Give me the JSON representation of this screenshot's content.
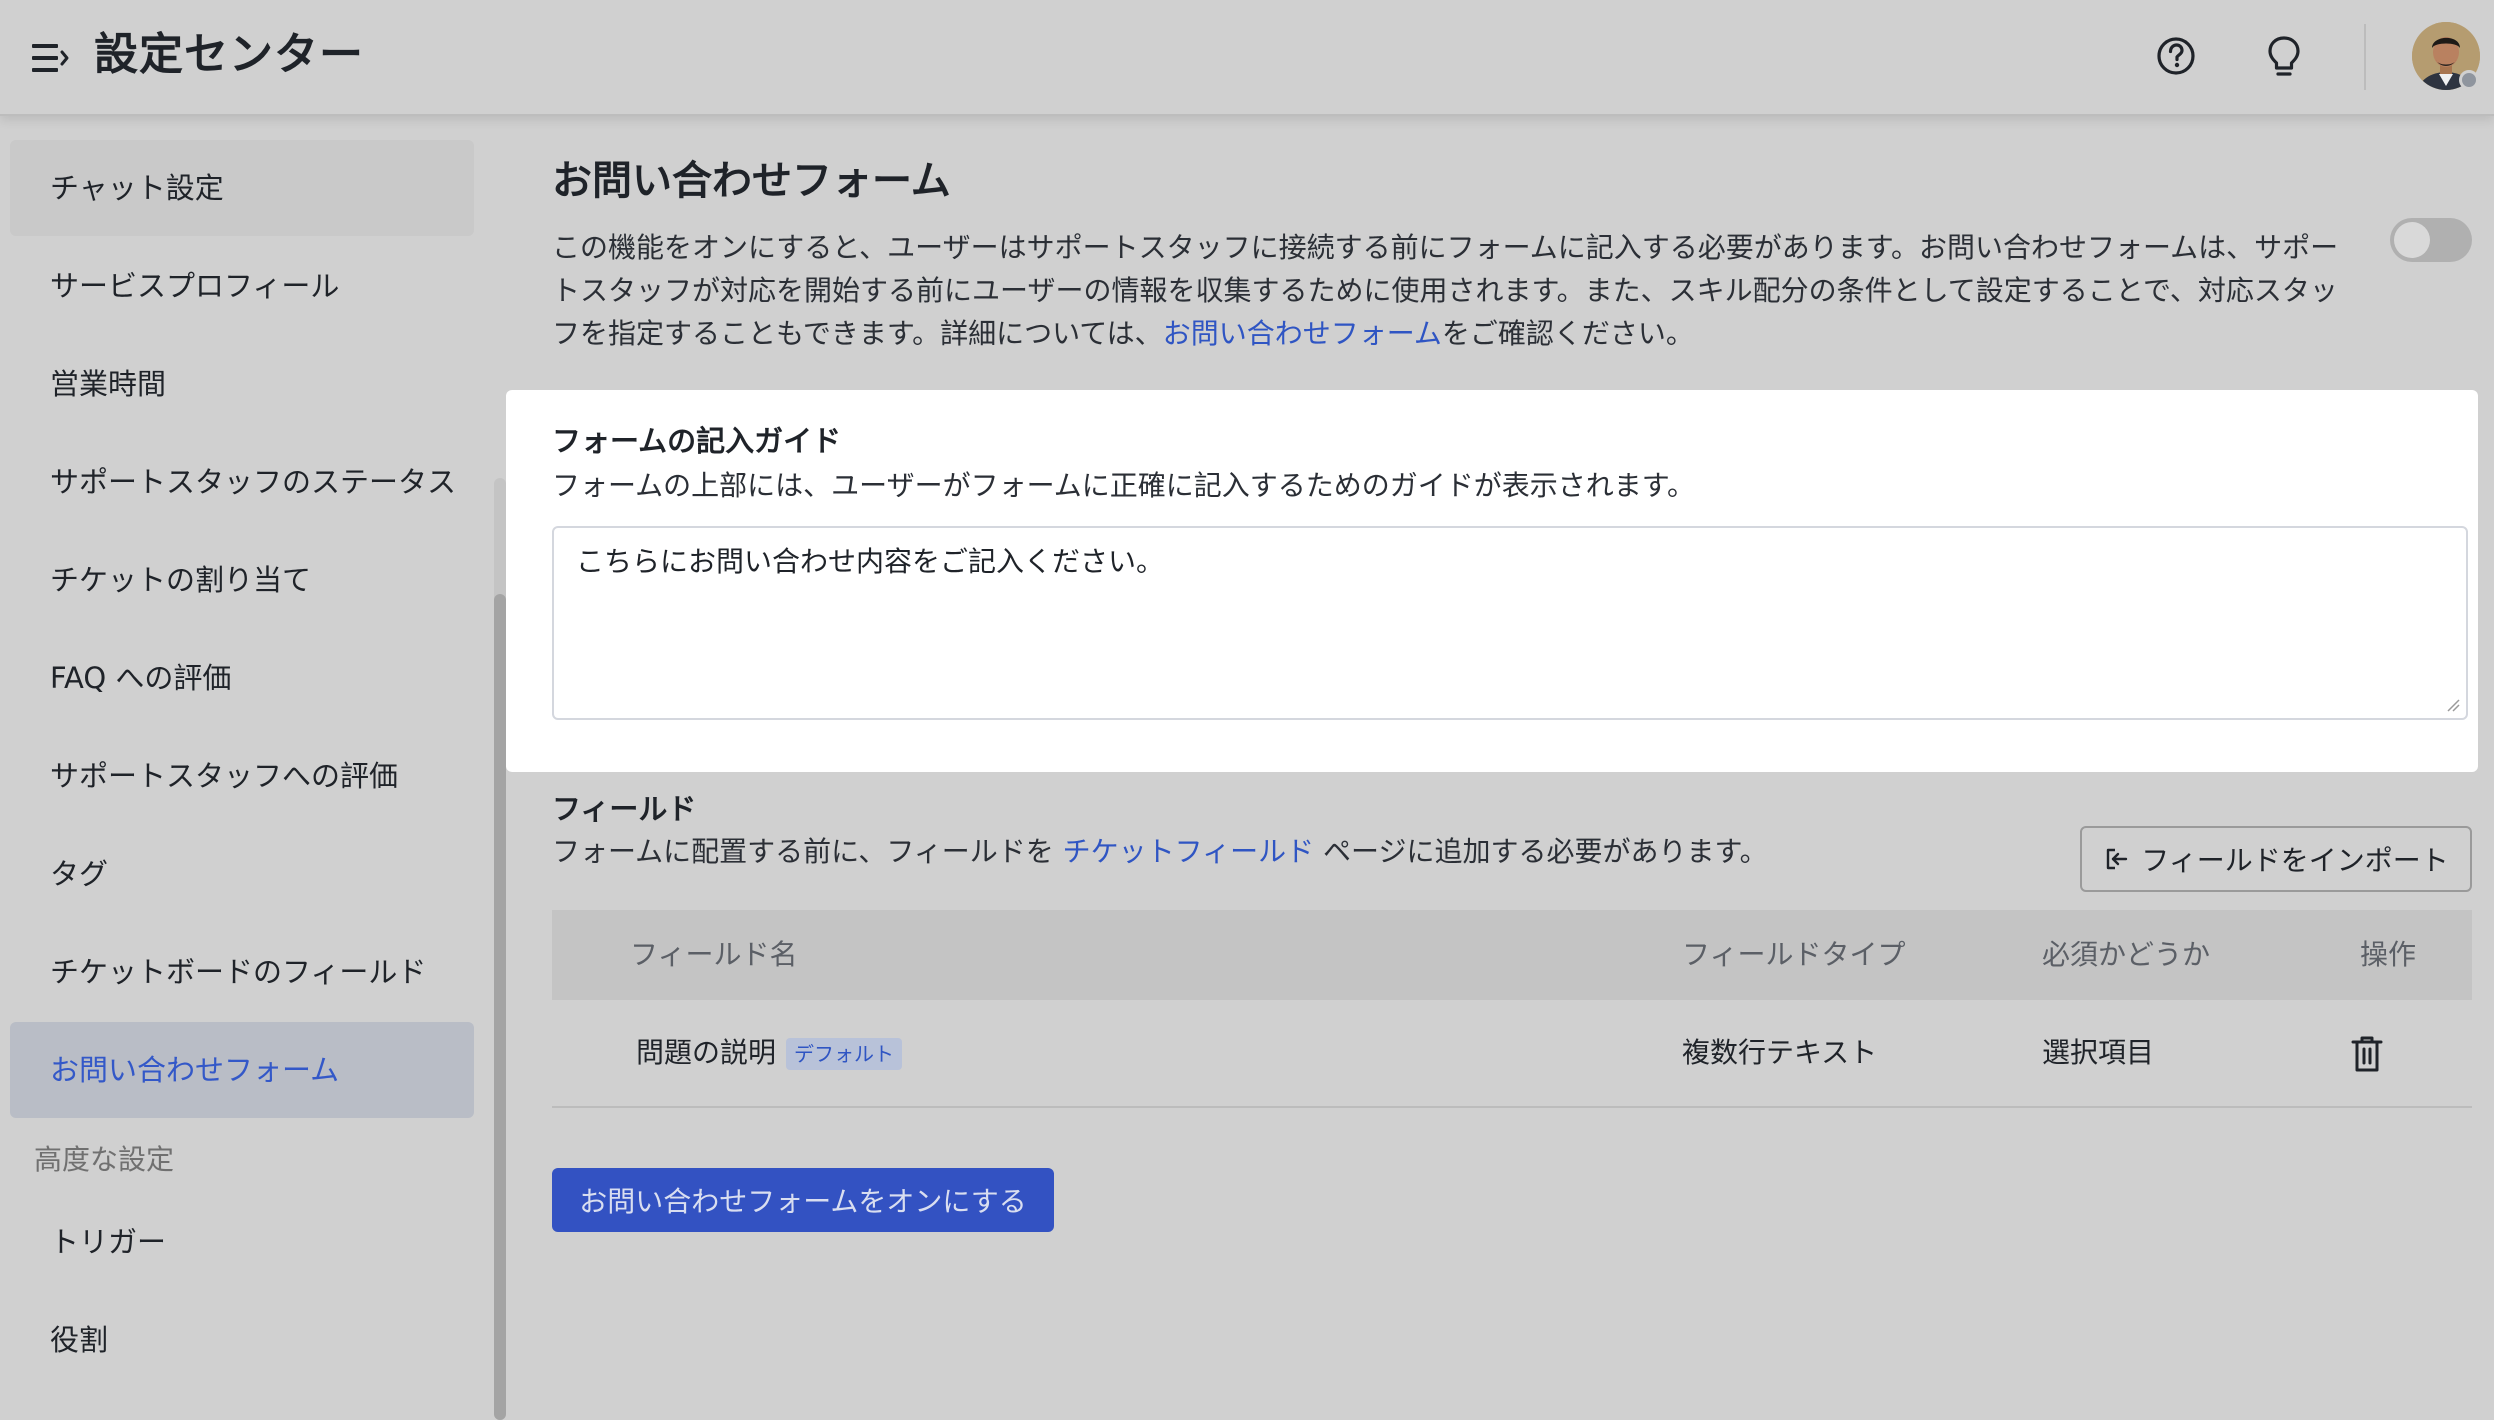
{
  "header": {
    "title": "設定センター"
  },
  "sidebar": {
    "items": [
      {
        "label": "チャット設定"
      },
      {
        "label": "サービスプロフィール"
      },
      {
        "label": "営業時間"
      },
      {
        "label": "サポートスタッフのステータス"
      },
      {
        "label": "チケットの割り当て"
      },
      {
        "label": "FAQ への評価"
      },
      {
        "label": "サポートスタッフへの評価"
      },
      {
        "label": "タグ"
      },
      {
        "label": "チケットボードのフィールド"
      },
      {
        "label": "お問い合わせフォーム"
      }
    ],
    "active_index": 9,
    "section_label": "高度な設定",
    "advanced_items": [
      {
        "label": "トリガー"
      },
      {
        "label": "役割"
      }
    ]
  },
  "main": {
    "heading": "お問い合わせフォーム",
    "toggle_on": false,
    "intro_text": "この機能をオンにすると、ユーザーはサポートスタッフに接続する前にフォームに記入する必要があります。お問い合わせフォームは、サポートスタッフが対応を開始する前にユーザーの情報を収集するために使用されます。また、スキル配分の条件として設定することで、対応スタッフを指定することもできます。詳細については、",
    "intro_link": "お問い合わせフォーム",
    "intro_suffix": "をご確認ください。",
    "guide": {
      "title": "フォームの記入ガイド",
      "subtitle": "フォームの上部には、ユーザーがフォームに正確に記入するためのガイドが表示されます。",
      "value": "こちらにお問い合わせ内容をご記入ください。"
    },
    "fields": {
      "title": "フィールド",
      "sub_prefix": "フォームに配置する前に、フィールドを ",
      "sub_link": "チケットフィールド",
      "sub_suffix": " ページに追加する必要があります。",
      "import_label": "フィールドをインポート"
    },
    "table": {
      "headers": [
        "フィールド名",
        "フィールドタイプ",
        "必須かどうか",
        "操作"
      ],
      "rows": [
        {
          "name": "問題の説明",
          "badge": "デフォルト",
          "type": "複数行テキスト",
          "required": "選択項目"
        }
      ]
    },
    "enable_button": "お問い合わせフォームをオンにする"
  },
  "colors": {
    "accent": "#3352c2",
    "link": "#2f55c3",
    "background": "#d0d0d0"
  }
}
